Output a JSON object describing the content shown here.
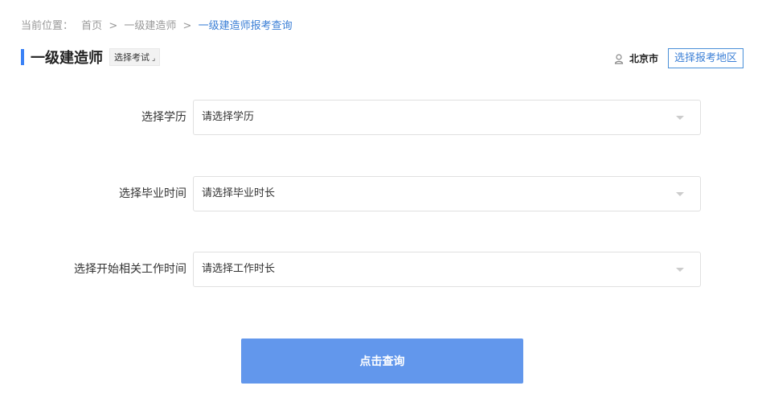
{
  "breadcrumb": {
    "prefix": "当前位置：",
    "sep": ">",
    "items": [
      "首页",
      "一级建造师",
      "一级建造师报考查询"
    ]
  },
  "header": {
    "title": "一级建造师",
    "exam_select_label": "选择考试",
    "city": "北京市",
    "region_button": "选择报考地区"
  },
  "form": {
    "rows": [
      {
        "label": "选择学历",
        "value": "请选择学历"
      },
      {
        "label": "选择毕业时间",
        "value": "请选择毕业时长"
      },
      {
        "label": "选择开始相关工作时间",
        "value": "请选择工作时长"
      }
    ],
    "submit_label": "点击查询"
  },
  "colors": {
    "accent": "#3b82f6",
    "link": "#3b7fd6",
    "button": "#6297ec"
  }
}
